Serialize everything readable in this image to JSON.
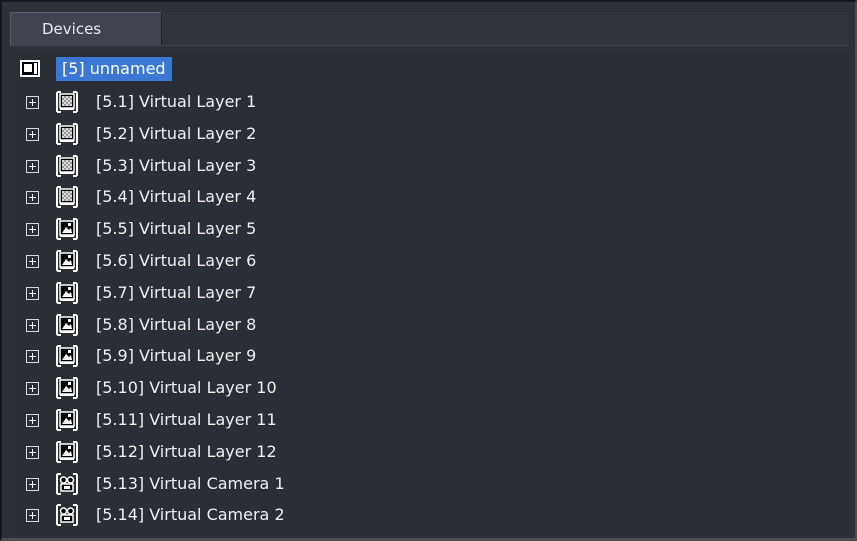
{
  "panel": {
    "tab_label": "Devices"
  },
  "tree": {
    "root": {
      "label": "[5] unnamed",
      "icon": "computer-icon",
      "selected": true
    },
    "items": [
      {
        "label": "[5.1] Virtual Layer 1",
        "icon": "layer-pattern-icon"
      },
      {
        "label": "[5.2] Virtual Layer 2",
        "icon": "layer-pattern-icon"
      },
      {
        "label": "[5.3] Virtual Layer 3",
        "icon": "layer-pattern-icon"
      },
      {
        "label": "[5.4] Virtual Layer 4",
        "icon": "layer-pattern-icon"
      },
      {
        "label": "[5.5] Virtual Layer 5",
        "icon": "layer-image-icon"
      },
      {
        "label": "[5.6] Virtual Layer 6",
        "icon": "layer-image-icon"
      },
      {
        "label": "[5.7] Virtual Layer 7",
        "icon": "layer-image-icon"
      },
      {
        "label": "[5.8] Virtual Layer 8",
        "icon": "layer-image-icon"
      },
      {
        "label": "[5.9] Virtual Layer 9",
        "icon": "layer-image-icon"
      },
      {
        "label": "[5.10] Virtual Layer 10",
        "icon": "layer-image-icon"
      },
      {
        "label": "[5.11] Virtual Layer 11",
        "icon": "layer-image-icon"
      },
      {
        "label": "[5.12] Virtual Layer 12",
        "icon": "layer-image-icon"
      },
      {
        "label": "[5.13] Virtual Camera 1",
        "icon": "camera-icon"
      },
      {
        "label": "[5.14] Virtual Camera 2",
        "icon": "camera-icon"
      }
    ]
  },
  "colors": {
    "background": "#2d3138",
    "selection": "#3a78d4",
    "text": "#eef0f3"
  }
}
